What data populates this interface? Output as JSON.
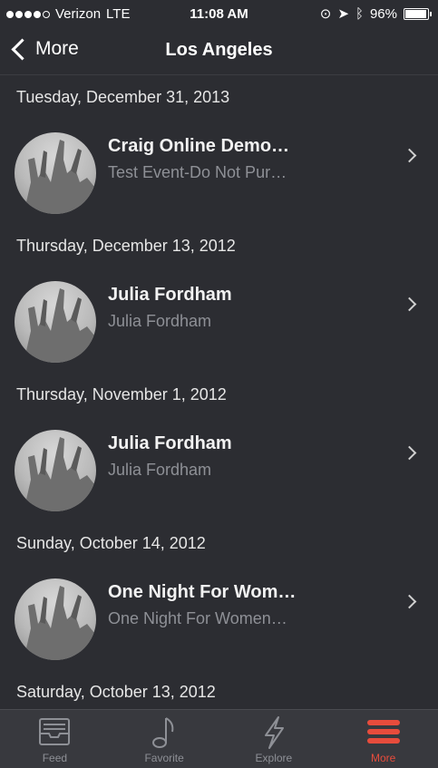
{
  "status_bar": {
    "carrier": "Verizon",
    "network": "LTE",
    "time": "11:08 AM",
    "battery": "96%"
  },
  "nav": {
    "back_label": "More",
    "title": "Los Angeles"
  },
  "sections": [
    {
      "date": "Tuesday, December 31, 2013",
      "title": "Craig Online Demo…",
      "subtitle": "Test Event-Do Not Pur…"
    },
    {
      "date": "Thursday, December 13, 2012",
      "title": "Julia Fordham",
      "subtitle": "Julia Fordham"
    },
    {
      "date": "Thursday, November 1, 2012",
      "title": "Julia Fordham",
      "subtitle": "Julia Fordham"
    },
    {
      "date": "Sunday, October 14, 2012",
      "title": "One Night For Wom…",
      "subtitle": "One Night For Women…"
    },
    {
      "date": "Saturday, October 13, 2012"
    }
  ],
  "tabs": [
    {
      "label": "Feed",
      "icon": "inbox-icon"
    },
    {
      "label": "Favorite",
      "icon": "music-note-icon"
    },
    {
      "label": "Explore",
      "icon": "lightning-icon"
    },
    {
      "label": "More",
      "icon": "menu-icon",
      "active": true
    }
  ],
  "colors": {
    "accent": "#e74c3c",
    "background": "#2c2d32"
  }
}
